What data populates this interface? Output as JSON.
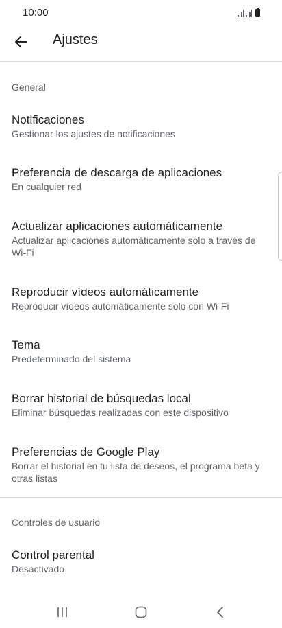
{
  "status_bar": {
    "time": "10:00",
    "icons": [
      "signal-icon",
      "signal-icon",
      "battery-icon"
    ]
  },
  "app_bar": {
    "back_icon": "arrow-left-icon",
    "title": "Ajustes"
  },
  "sections": [
    {
      "header": "General",
      "items": [
        {
          "title": "Notificaciones",
          "subtitle": "Gestionar los ajustes de notificaciones"
        },
        {
          "title": "Preferencia de descarga de aplicaciones",
          "subtitle": "En cualquier red"
        },
        {
          "title": "Actualizar aplicaciones automáticamente",
          "subtitle": "Actualizar aplicaciones automáticamente solo a través de Wi-Fi"
        },
        {
          "title": "Reproducir vídeos automáticamente",
          "subtitle": "Reproducir vídeos automáticamente solo con Wi-Fi"
        },
        {
          "title": "Tema",
          "subtitle": "Predeterminado del sistema"
        },
        {
          "title": "Borrar historial de búsquedas local",
          "subtitle": "Eliminar búsquedas realizadas con este dispositivo"
        },
        {
          "title": "Preferencias de Google Play",
          "subtitle": "Borrar el historial en tu lista de deseos, el programa beta y otras listas"
        }
      ]
    },
    {
      "header": "Controles de usuario",
      "items": [
        {
          "title": "Control parental",
          "subtitle": "Desactivado"
        }
      ]
    }
  ],
  "nav_bar": {
    "buttons": [
      "recent-apps-icon",
      "home-icon",
      "back-icon"
    ]
  },
  "colors": {
    "primary_text": "#202124",
    "secondary_text": "#5f6368",
    "divider": "#dadce0"
  }
}
